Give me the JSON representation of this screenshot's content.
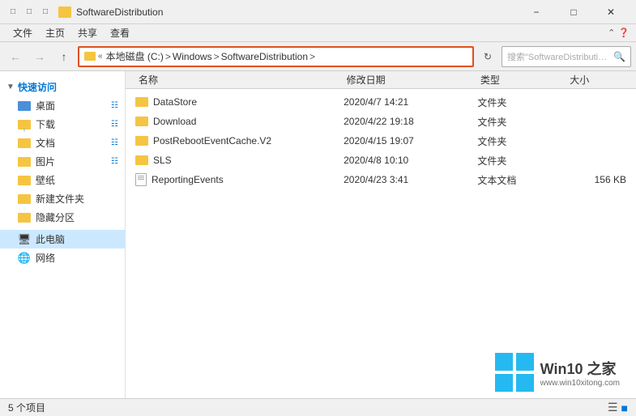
{
  "window": {
    "title": "SoftwareDistribution",
    "title_full": "SoftwareDistribution"
  },
  "title_bar": {
    "icons": [
      "back",
      "forward",
      "up"
    ],
    "folder_label": "SoftwareDistribution",
    "controls": [
      "minimize",
      "maximize",
      "close"
    ]
  },
  "menu": {
    "items": [
      "文件",
      "主页",
      "共享",
      "查看"
    ]
  },
  "nav": {
    "back_title": "后退",
    "forward_title": "前进",
    "up_title": "向上",
    "address_parts": [
      "本地磁盘 (C:)",
      "Windows",
      "SoftwareDistribution"
    ],
    "search_placeholder": "搜索\"SoftwareDistribution\""
  },
  "sidebar": {
    "quick_access_label": "快速访问",
    "items": [
      {
        "label": "桌面",
        "type": "folder",
        "pinned": true
      },
      {
        "label": "下载",
        "type": "download",
        "pinned": true
      },
      {
        "label": "文档",
        "type": "folder",
        "pinned": true
      },
      {
        "label": "图片",
        "type": "folder",
        "pinned": true
      },
      {
        "label": "壁纸",
        "type": "folder"
      },
      {
        "label": "新建文件夹",
        "type": "folder"
      },
      {
        "label": "隐藏分区",
        "type": "folder"
      }
    ],
    "this_pc_label": "此电脑",
    "network_label": "网络"
  },
  "columns": {
    "name": "名称",
    "date": "修改日期",
    "type": "类型",
    "size": "大小"
  },
  "files": [
    {
      "name": "DataStore",
      "date": "2020/4/7 14:21",
      "type": "文件夹",
      "size": "",
      "icon": "folder"
    },
    {
      "name": "Download",
      "date": "2020/4/22 19:18",
      "type": "文件夹",
      "size": "",
      "icon": "folder"
    },
    {
      "name": "PostRebootEventCache.V2",
      "date": "2020/4/15 19:07",
      "type": "文件夹",
      "size": "",
      "icon": "folder"
    },
    {
      "name": "SLS",
      "date": "2020/4/8 10:10",
      "type": "文件夹",
      "size": "",
      "icon": "folder"
    },
    {
      "name": "ReportingEvents",
      "date": "2020/4/23 3:41",
      "type": "文本文档",
      "size": "156 KB",
      "icon": "doc"
    }
  ],
  "status_bar": {
    "item_count": "5 个项目"
  },
  "watermark": {
    "text": "Win10 之家",
    "url": "www.win10xitong.com"
  }
}
